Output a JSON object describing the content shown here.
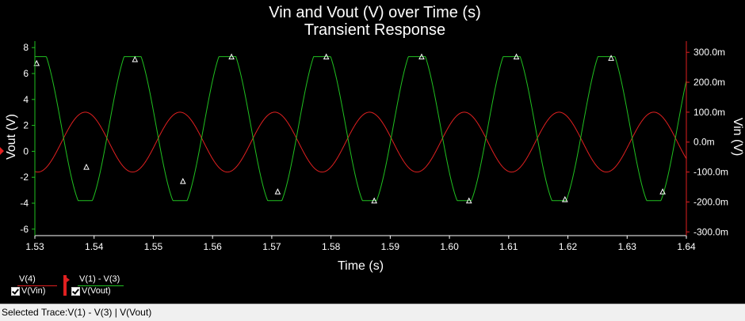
{
  "chart_data": {
    "type": "line",
    "title": "Vin and Vout (V) over Time (s)",
    "subtitle": "Transient Response",
    "xlabel": "Time (s)",
    "ylabel_left": "Vout (V)",
    "ylabel_right": "Vin (V)",
    "xlim": [
      1.53,
      1.64
    ],
    "ylim_left": [
      -6.5,
      8.5
    ],
    "ylim_right": [
      -0.3125,
      0.3375
    ],
    "x_ticks": [
      "1.53",
      "1.54",
      "1.55",
      "1.56",
      "1.57",
      "1.58",
      "1.59",
      "1.60",
      "1.61",
      "1.62",
      "1.63",
      "1.64"
    ],
    "y_ticks_left": [
      "8",
      "6",
      "4",
      "2",
      "0",
      "-2",
      "-4",
      "-6"
    ],
    "y_ticks_right": [
      "300.0m",
      "200.0m",
      "100.0m",
      "0.0m",
      "-100.0m",
      "-200.0m",
      "-300.0m"
    ],
    "grid": false,
    "series": [
      {
        "name": "V(Vin)",
        "axis": "right",
        "color": "#e02020",
        "waveform": "sine",
        "amplitude": 0.1,
        "offset": 0,
        "period": 0.016,
        "peak_time": 1.5385
      },
      {
        "name": "V(Vout)",
        "axis": "left",
        "color": "#20c020",
        "waveform": "clipped-sine",
        "amplitude": 6.4,
        "offset": 1.9,
        "clip_high": 7.3,
        "clip_low": -3.8,
        "period": 0.016,
        "peak_time": 1.5465,
        "markers_x": [
          1.5303,
          1.5387,
          1.5469,
          1.555,
          1.5632,
          1.571,
          1.5792,
          1.5873,
          1.5953,
          1.6033,
          1.6113,
          1.6195,
          1.6273,
          1.636
        ],
        "markers_y": [
          6.8,
          -1.2,
          7.1,
          -2.3,
          7.3,
          -3.1,
          7.3,
          -3.8,
          7.3,
          -3.8,
          7.3,
          -3.7,
          7.2,
          -3.1
        ]
      }
    ]
  },
  "legend": {
    "item1_top": "V(4)",
    "item1_bottom": "V(Vin)",
    "item1_color": "#e02020",
    "item2_top": "V(1) - V(3)",
    "item2_bottom": "V(Vout)",
    "item2_color": "#20c020"
  },
  "status": {
    "text": "Selected Trace:V(1) - V(3) | V(Vout)"
  }
}
